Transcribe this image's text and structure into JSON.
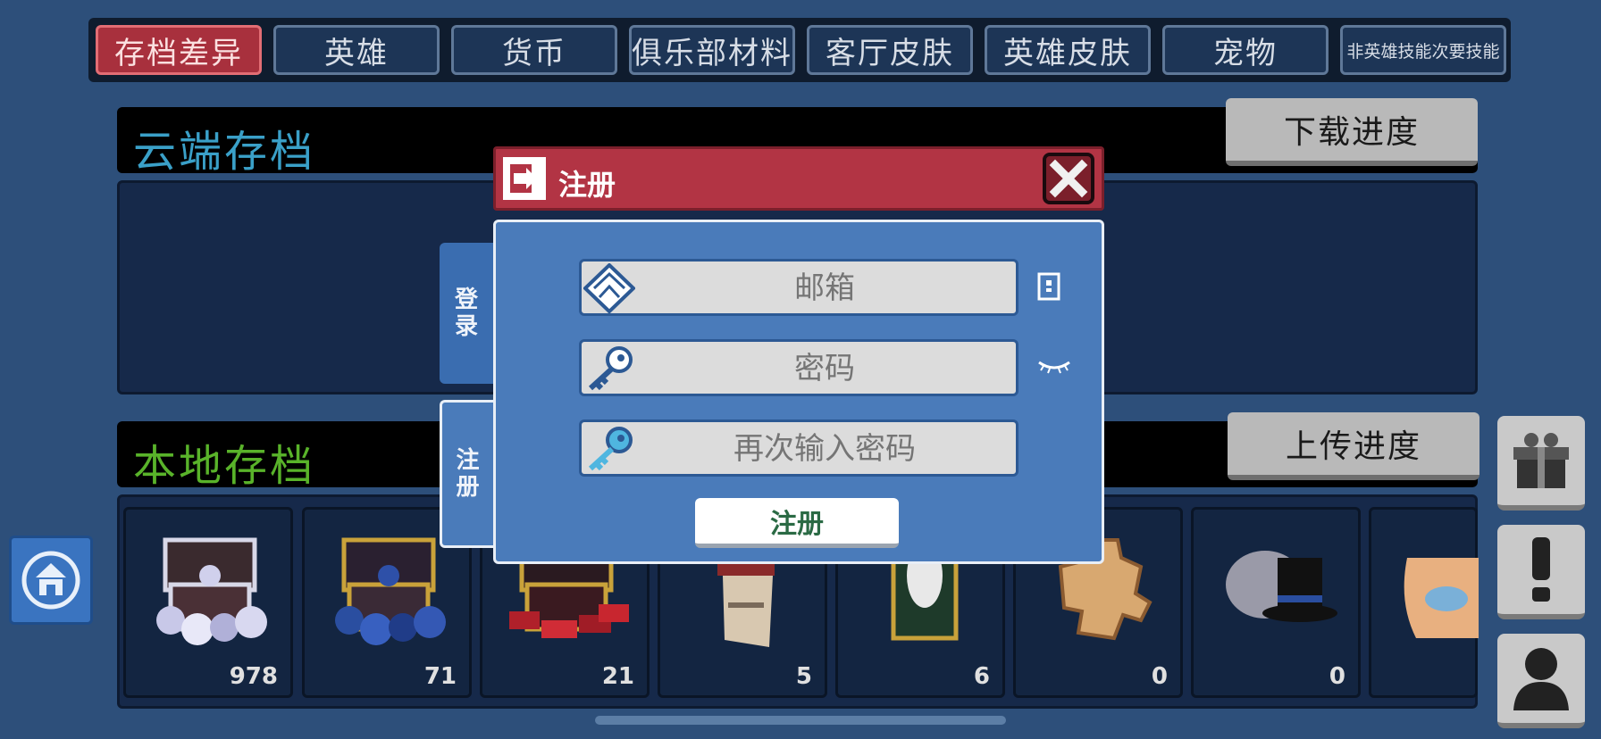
{
  "tabs": [
    {
      "label": "存档差异",
      "active": true
    },
    {
      "label": "英雄"
    },
    {
      "label": "货币"
    },
    {
      "label": "俱乐部材料"
    },
    {
      "label": "客厅皮肤"
    },
    {
      "label": "英雄皮肤"
    },
    {
      "label": "宠物"
    },
    {
      "label": "非英雄技能次要技能"
    }
  ],
  "cloud": {
    "title": "云端存档",
    "button": "下载进度"
  },
  "local": {
    "title": "本地存档",
    "button": "上传进度"
  },
  "items": [
    {
      "icon": "silver-gem-chest-icon",
      "count": "978"
    },
    {
      "icon": "blue-gem-chest-icon",
      "count": "71"
    },
    {
      "icon": "red-gem-chest-icon",
      "count": "21"
    },
    {
      "icon": "upgrade-ticket-icon",
      "count": "5"
    },
    {
      "icon": "skin-card-icon",
      "count": "6"
    },
    {
      "icon": "puzzle-piece-icon",
      "count": "0"
    },
    {
      "icon": "top-hat-icon",
      "count": "0"
    },
    {
      "icon": "fish-bag-icon",
      "count": ""
    }
  ],
  "dialog": {
    "title": "注册",
    "tabs": {
      "login": "登\n录",
      "register": "注\n册"
    },
    "email_placeholder": "邮箱",
    "password_placeholder": "密码",
    "confirm_placeholder": "再次输入密码",
    "submit": "注册"
  },
  "colors": {
    "accent": "#b23444",
    "background": "#2d4f7a",
    "dialog": "#4a7bba"
  }
}
